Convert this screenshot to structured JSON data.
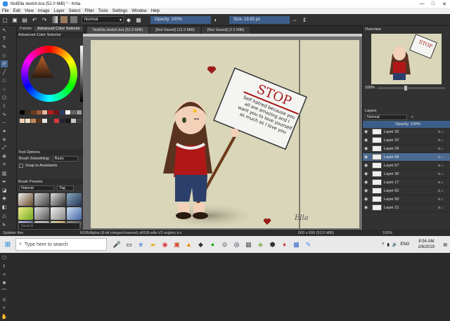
{
  "window": {
    "title": "NutElla sketch.kra (52.0 MiB) * - Krita",
    "controls": [
      "—",
      "□",
      "✕"
    ]
  },
  "menu": [
    "File",
    "Edit",
    "View",
    "Image",
    "Layer",
    "Select",
    "Filter",
    "Tools",
    "Settings",
    "Window",
    "Help"
  ],
  "toolbar": {
    "blend_mode": "Normal",
    "opacity_label": "Opacity: 100%",
    "size_label": "Size: 19.83 px"
  },
  "left_panel": {
    "tabs": [
      "Palette",
      "Advanced Color Selector"
    ],
    "color_selector_title": "Advanced Color Selector",
    "tool_options_title": "Tool Options",
    "brush_smoothing_label": "Brush Smoothing:",
    "brush_smoothing_value": "Basic",
    "snap_label": "Snap to Assistants",
    "brush_presets_title": "Brush Presets",
    "preset_filter": "Natural",
    "preset_tag": "Tag",
    "search_placeholder": "Search"
  },
  "document_tabs": [
    "NutElla sketch.kra (52.0 MiB)",
    "[Not Saved] (13.3 MiB)",
    "[Not Saved] (2.2 MiB)"
  ],
  "sign": {
    "heading": "STOP",
    "lines": [
      "Self hatred because you",
      "all are amazing and I",
      "want you to love yourself",
      "as much as I love you"
    ],
    "signature": "Ella"
  },
  "overview": {
    "title": "Overview",
    "zoom": "100%"
  },
  "layers_panel": {
    "title": "Layers",
    "blend": "Normal",
    "opacity": "Opacity: 100%",
    "items": [
      {
        "name": "Layer 32",
        "active": false
      },
      {
        "name": "Layer 22",
        "active": false
      },
      {
        "name": "Layer 29",
        "active": false
      },
      {
        "name": "Layer 68",
        "active": true
      },
      {
        "name": "Layer 57",
        "active": false
      },
      {
        "name": "Layer 30",
        "active": false
      },
      {
        "name": "Layer 17",
        "active": false
      },
      {
        "name": "Layer 62",
        "active": false
      },
      {
        "name": "Layer 50",
        "active": false
      },
      {
        "name": "Layer 21",
        "active": false
      }
    ]
  },
  "status": {
    "brush": "Splatter thin",
    "color_space": "RGB/Alpha (8-bit integer/channel)  sRGB-elle-V2-srgbtrc.icc",
    "dimensions": "600 x 600 (52.0 MiB)",
    "zoom": "100%"
  },
  "taskbar": {
    "search_placeholder": "Type here to search",
    "lang": "ENG",
    "time": "8:54 AM",
    "date": "2/6/2019"
  }
}
